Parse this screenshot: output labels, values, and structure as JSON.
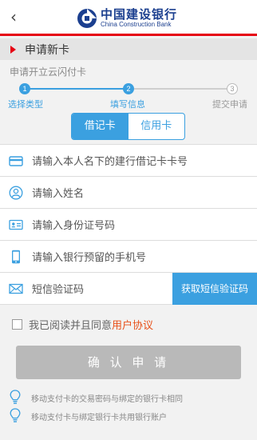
{
  "header": {
    "back_icon": "chevron-left-icon",
    "brand_cn": "中国建设银行",
    "brand_en": "China Construction Bank",
    "accent_color": "#e60012",
    "brand_color": "#1b3f8f"
  },
  "section": {
    "title": "申请新卡",
    "subtitle": "申请开立云闪付卡"
  },
  "stepper": {
    "current_step": 2,
    "steps": [
      {
        "number": "1",
        "label": "选择类型"
      },
      {
        "number": "2",
        "label": "填写信息"
      },
      {
        "number": "3",
        "label": "提交申请"
      }
    ],
    "active_color": "#3ba0e0"
  },
  "card_type": {
    "options": [
      "借记卡",
      "信用卡"
    ],
    "selected": "借记卡"
  },
  "form": {
    "card_number": {
      "icon": "card-icon",
      "placeholder": "请输入本人名下的建行借记卡卡号"
    },
    "name": {
      "icon": "person-icon",
      "placeholder": "请输入姓名"
    },
    "id_number": {
      "icon": "id-card-icon",
      "placeholder": "请输入身份证号码"
    },
    "phone": {
      "icon": "phone-icon",
      "placeholder": "请输入银行预留的手机号"
    },
    "sms_code": {
      "icon": "envelope-icon",
      "placeholder": "短信验证码",
      "button_label": "获取短信验证码"
    }
  },
  "agreement": {
    "checked": false,
    "text": "我已阅读并且同意",
    "link": "用户协议"
  },
  "confirm_label": "确 认 申 请",
  "tips": [
    {
      "icon": "lightbulb-icon",
      "text": "移动支付卡的交易密码与绑定的银行卡相同"
    },
    {
      "icon": "lightbulb-icon",
      "text": "移动支付卡与绑定银行卡共用银行账户"
    }
  ]
}
